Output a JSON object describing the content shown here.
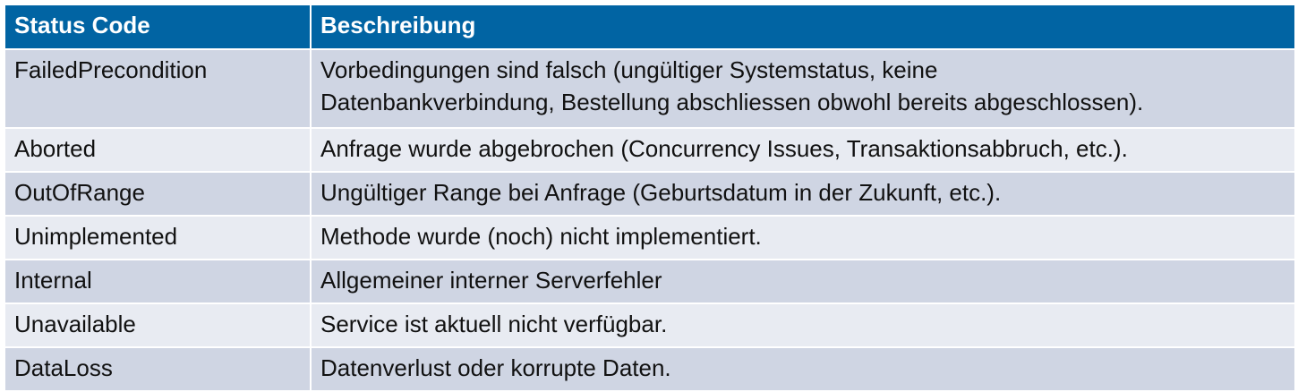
{
  "table": {
    "headers": [
      "Status Code",
      "Beschreibung"
    ],
    "rows": [
      {
        "code": "FailedPrecondition",
        "desc_lines": [
          "Vorbedingungen sind falsch (ungültiger Systemstatus, keine",
          "Datenbankverbindung, Bestellung abschliessen obwohl bereits abgeschlossen)."
        ]
      },
      {
        "code": "Aborted",
        "desc": "Anfrage wurde abgebrochen (Concurrency Issues, Transaktionsabbruch, etc.)."
      },
      {
        "code": "OutOfRange",
        "desc": "Ungültiger Range bei Anfrage (Geburtsdatum in der Zukunft, etc.)."
      },
      {
        "code": "Unimplemented",
        "desc": "Methode wurde (noch) nicht implementiert."
      },
      {
        "code": "Internal",
        "desc": "Allgemeiner interner Serverfehler"
      },
      {
        "code": "Unavailable",
        "desc": "Service ist aktuell nicht verfügbar."
      },
      {
        "code": "DataLoss",
        "desc": "Datenverlust oder korrupte Daten."
      }
    ]
  },
  "colors": {
    "header_bg": "#0164a3",
    "row_odd_bg": "#cfd5e3",
    "row_even_bg": "#e8ebf2"
  }
}
